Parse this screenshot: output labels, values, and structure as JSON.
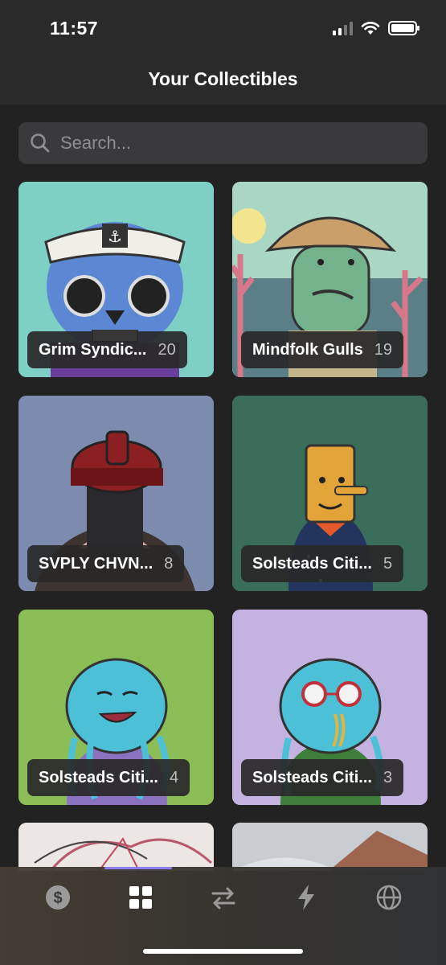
{
  "status_bar": {
    "time": "11:57"
  },
  "header": {
    "title": "Your Collectibles"
  },
  "search": {
    "placeholder": "Search..."
  },
  "collections": [
    {
      "name": "Grim Syndic...",
      "count": "20",
      "bg": "#7ecfc4"
    },
    {
      "name": "Mindfolk Gulls",
      "count": "19",
      "bg": "#a9d7c3"
    },
    {
      "name": "SVPLY CHVN...",
      "count": "8",
      "bg": "#7d8cae"
    },
    {
      "name": "Solsteads Citi...",
      "count": "5",
      "bg": "#3a6e5a"
    },
    {
      "name": "Solsteads Citi...",
      "count": "4",
      "bg": "#8bbd56"
    },
    {
      "name": "Solsteads Citi...",
      "count": "3",
      "bg": "#c4b2e0"
    }
  ],
  "tabs": [
    {
      "icon": "dollar-icon",
      "active": false
    },
    {
      "icon": "grid-icon",
      "active": true
    },
    {
      "icon": "swap-icon",
      "active": false
    },
    {
      "icon": "lightning-icon",
      "active": false
    },
    {
      "icon": "globe-icon",
      "active": false
    }
  ],
  "colors": {
    "accent": "#8b7cf6",
    "background": "#222222",
    "card_label": "#282828"
  }
}
